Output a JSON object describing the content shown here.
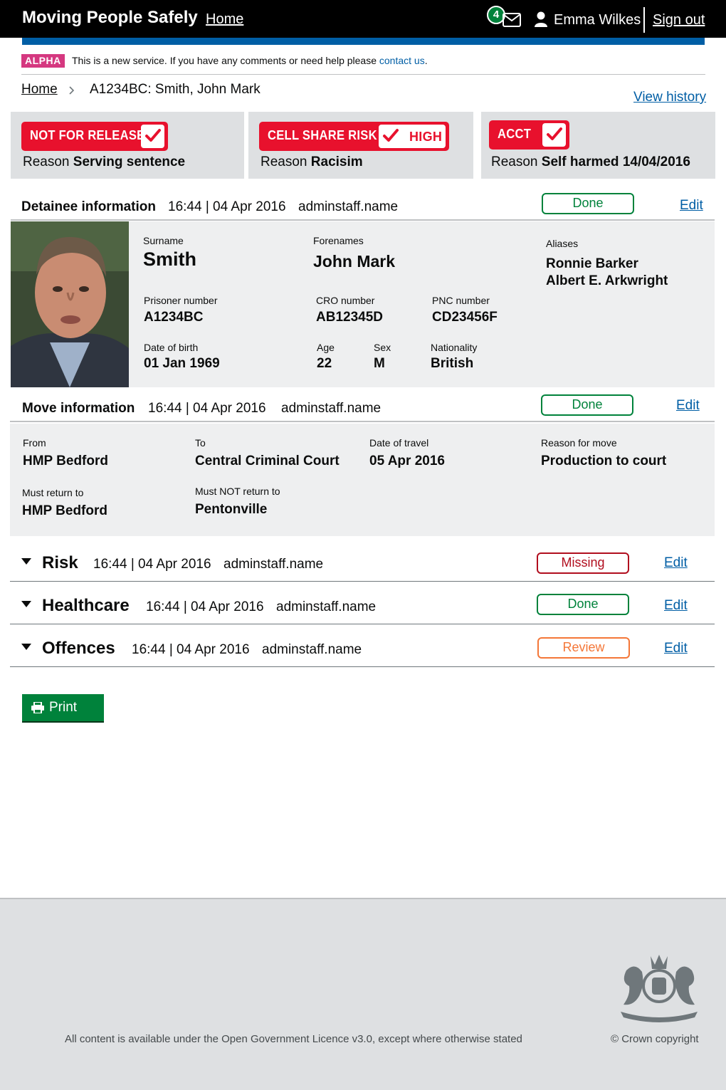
{
  "header": {
    "brand": "Moving People Safely",
    "home": "Home",
    "message_count": "4",
    "user_name": "Emma Wilkes",
    "sign_out": "Sign out"
  },
  "phase": {
    "tag": "ALPHA",
    "text_before": "This is a new service. If you have any comments or need help please ",
    "link": "contact us",
    "text_after": "."
  },
  "breadcrumb": {
    "home": "Home",
    "current": "A1234BC: Smith, John Mark"
  },
  "view_history": "View history",
  "alerts": [
    {
      "label": "NOT FOR RELEASE",
      "reason_prefix": "Reason ",
      "reason": "Serving sentence"
    },
    {
      "label": "CELL SHARE RISK",
      "level": "HIGH",
      "reason_prefix": "Reason ",
      "reason": "Racisim"
    },
    {
      "label": "ACCT",
      "reason_prefix": "Reason ",
      "reason": "Self harmed 14/04/2016"
    }
  ],
  "detainee": {
    "title": "Detainee information",
    "timestamp": "16:44 | 04 Apr 2016",
    "user": "adminstaff.name",
    "status": "Done",
    "edit": "Edit",
    "surname_label": "Surname",
    "surname": "Smith",
    "forenames_label": "Forenames",
    "forenames": "John Mark",
    "aliases_label": "Aliases",
    "aliases": [
      "Ronnie Barker",
      "Albert E. Arkwright"
    ],
    "prisoner_number_label": "Prisoner number",
    "prisoner_number": "A1234BC",
    "cro_label": "CRO number",
    "cro": "AB12345D",
    "pnc_label": "PNC number",
    "pnc": "CD23456F",
    "dob_label": "Date of birth",
    "dob": "01 Jan 1969",
    "age_label": "Age",
    "age": "22",
    "sex_label": "Sex",
    "sex": "M",
    "nationality_label": "Nationality",
    "nationality": "British"
  },
  "move": {
    "title": "Move information",
    "timestamp": "16:44 | 04 Apr 2016",
    "user": "adminstaff.name",
    "status": "Done",
    "edit": "Edit",
    "from_label": "From",
    "from": "HMP Bedford",
    "to_label": "To",
    "to": "Central Criminal Court",
    "date_label": "Date of travel",
    "date": "05 Apr 2016",
    "reason_label": "Reason for move",
    "reason": "Production to court",
    "return_label": "Must return to",
    "return": "HMP Bedford",
    "not_return_label": "Must NOT return to",
    "not_return": "Pentonville"
  },
  "sections": [
    {
      "title": "Risk",
      "timestamp": "16:44 | 04 Apr 2016",
      "user": "adminstaff.name",
      "status": "Missing",
      "edit": "Edit"
    },
    {
      "title": "Healthcare",
      "timestamp": "16:44 | 04 Apr 2016",
      "user": "adminstaff.name",
      "status": "Done",
      "edit": "Edit"
    },
    {
      "title": "Offences",
      "timestamp": "16:44 | 04 Apr 2016",
      "user": "adminstaff.name",
      "status": "Review",
      "edit": "Edit"
    }
  ],
  "print_label": "Print",
  "footer": {
    "licence_before": "All content is available under the ",
    "licence_link": "Open Government Licence v3.0",
    "licence_after": ", except where otherwise stated",
    "copyright": "© Crown copyright"
  },
  "colors": {
    "header_bg": "#000000",
    "brand_blue": "#005ea5",
    "alert_red": "#e8112d",
    "done_green": "#00823b",
    "missing_red": "#b10e1e",
    "review_orange": "#f47738",
    "alpha_pink": "#d53880",
    "panel_grey": "#eeeff0"
  },
  "icons": [
    "envelope-icon",
    "user-icon",
    "chevron-right-icon",
    "check-icon",
    "triangle-down-icon",
    "printer-icon",
    "royal-crest-icon"
  ]
}
